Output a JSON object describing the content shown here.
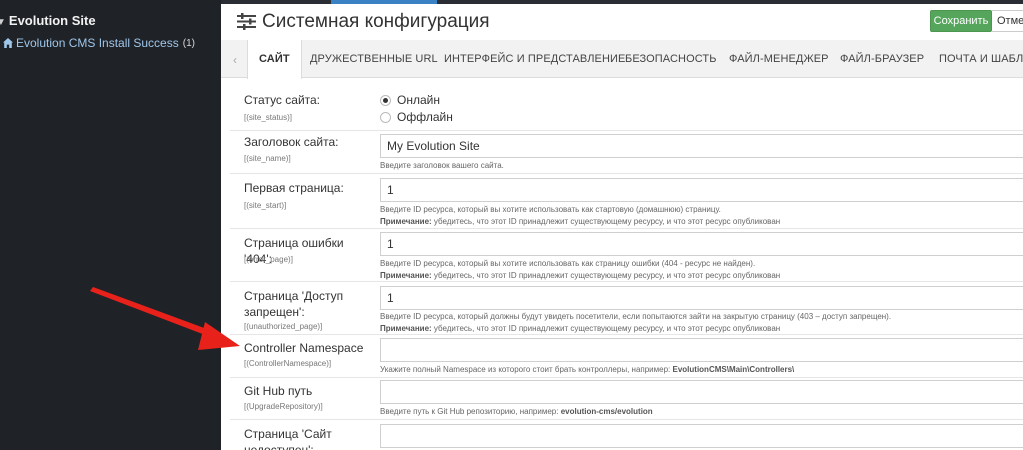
{
  "sidebar": {
    "root_label": "Evolution Site",
    "item_label": "Evolution CMS Install Success",
    "item_count": "(1)"
  },
  "header": {
    "title": "Системная конфигурация",
    "save_label": "Сохранить",
    "cancel_label": "Отмена"
  },
  "tabs": [
    {
      "label": "САЙТ"
    },
    {
      "label": "ДРУЖЕСТВЕННЫЕ URL"
    },
    {
      "label": "ИНТЕРФЕЙС И ПРЕДСТАВЛЕНИЕ"
    },
    {
      "label": "БЕЗОПАСНОСТЬ"
    },
    {
      "label": "ФАЙЛ-МЕНЕДЖЕР"
    },
    {
      "label": "ФАЙЛ-БРАУЗЕР"
    },
    {
      "label": "ПОЧТА И ШАБЛОНЫ"
    }
  ],
  "form": {
    "site_status": {
      "label": "Статус сайта:",
      "key": "[(site_status)]",
      "option_online": "Онлайн",
      "option_offline": "Оффлайн",
      "selected": "online"
    },
    "site_name": {
      "label": "Заголовок сайта:",
      "key": "[(site_name)]",
      "value": "My Evolution Site",
      "hint": "Введите заголовок вашего сайта."
    },
    "site_start": {
      "label": "Первая страница:",
      "key": "[(site_start)]",
      "value": "1",
      "hint": "Введите ID ресурса, который вы хотите использовать как стартовую (домашнюю) страницу.",
      "note_label": "Примечание:",
      "note": " убедитесь, что этот ID принадлежит существующему ресурсу, и что этот ресурс опубликован"
    },
    "error_page": {
      "label": "Страница ошибки '404':",
      "key": "[(error_page)]",
      "value": "1",
      "hint": "Введите ID ресурса, который вы хотите использовать как страницу ошибки (404 - ресурс не найден).",
      "note_label": "Примечание:",
      "note": " убедитесь, что этот ID принадлежит существующему ресурсу, и что этот ресурс опубликован"
    },
    "unauthorized_page": {
      "label": "Страница 'Доступ запрещен':",
      "key": "[(unauthorized_page)]",
      "value": "1",
      "hint": "Введите ID ресурса, который должны будут увидеть посетители, если попытаются зайти на закрытую страницу (403 – доступ запрещен).",
      "note_label": "Примечание:",
      "note": " убедитесь, что этот ID принадлежит существующему ресурсу, и что этот ресурс опубликован"
    },
    "controller_namespace": {
      "label": "Controller Namespace",
      "key": "[(ControllerNamespace)]",
      "value": "",
      "hint": "Укажите полный Namespace из которого стоит брать контроллеры, например: ",
      "hint_example": "EvolutionCMS\\Main\\Controllers\\"
    },
    "upgrade_repository": {
      "label": "Git Hub путь",
      "key": "[(UpgradeRepository)]",
      "value": "",
      "hint": "Введите путь к Git Hub репозиторию, например: ",
      "hint_example": "evolution-cms/evolution"
    },
    "site_unavailable": {
      "label": "Страница 'Сайт недоступен':",
      "value": ""
    }
  },
  "colors": {
    "sidebar_bg": "#1f2227",
    "save_button": "#55a55c",
    "arrow": "#e8221b",
    "accent_blue": "#3b82c4"
  }
}
